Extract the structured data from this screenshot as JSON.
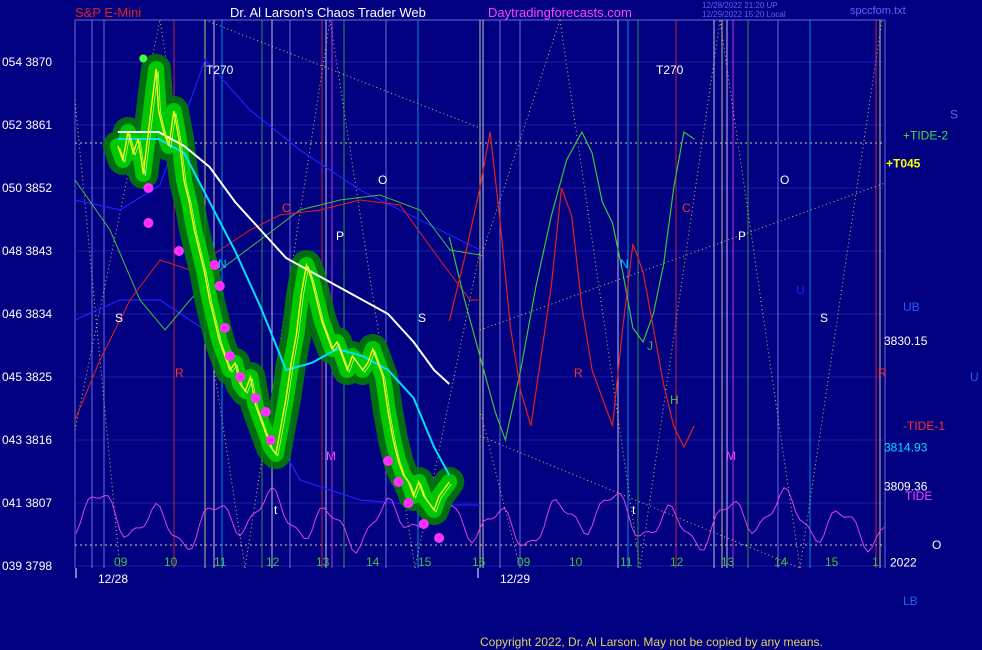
{
  "header": {
    "instrument": "S&P E-Mini",
    "site": "Dr. Al Larson's Chaos Trader Web",
    "url": "Daytradingforecasts.com",
    "stamp_line1": "12/28/2022 21:20 UP",
    "stamp_line2": "12/29/2022 15:20 Local",
    "filename": "spccfom.txt"
  },
  "footer": {
    "copyright": "Copyright 2022, Dr. Al Larson. May not be copied by any means."
  },
  "colors": {
    "background": "#000080",
    "plot_frame": "#6a6ad8",
    "price_line": "#ffff00",
    "bands": "#00c800",
    "magenta_dots": "#ff30ff",
    "moving_avg_slow": "#ffffff",
    "moving_avg_fast": "#00e0ff",
    "tide_green": "#40c040",
    "tide_red": "#e02020",
    "lower_oscillator": "#e040e0",
    "envelope_blue": "#2020ff"
  },
  "chart_data": {
    "type": "line",
    "title": "S&P E-Mini",
    "y_axis": {
      "range": [
        3798,
        3872
      ],
      "ticks": [
        {
          "price": 3870,
          "code": "054"
        },
        {
          "price": 3861,
          "code": "052"
        },
        {
          "price": 3852,
          "code": "050"
        },
        {
          "price": 3843,
          "code": "048"
        },
        {
          "price": 3834,
          "code": "046"
        },
        {
          "price": 3825,
          "code": "045"
        },
        {
          "price": 3816,
          "code": "043"
        },
        {
          "price": 3807,
          "code": "041"
        },
        {
          "price": 3798,
          "code": "039"
        }
      ]
    },
    "x_axis": {
      "hour_ticks": [
        "09",
        "10",
        "11",
        "12",
        "13",
        "14",
        "15",
        "16",
        "09",
        "10",
        "11",
        "12",
        "13",
        "14",
        "15",
        "1"
      ],
      "dates": [
        "12/28",
        "12/29"
      ]
    },
    "price_series": {
      "name": "price",
      "points": [
        [
          9.0,
          3858
        ],
        [
          9.1,
          3856
        ],
        [
          9.2,
          3860
        ],
        [
          9.3,
          3857
        ],
        [
          9.4,
          3859
        ],
        [
          9.5,
          3854
        ],
        [
          9.6,
          3860
        ],
        [
          9.7,
          3866
        ],
        [
          9.75,
          3869
        ],
        [
          9.8,
          3863
        ],
        [
          9.9,
          3860
        ],
        [
          10.0,
          3858
        ],
        [
          10.1,
          3863
        ],
        [
          10.2,
          3859
        ],
        [
          10.3,
          3853
        ],
        [
          10.4,
          3850
        ],
        [
          10.5,
          3846
        ],
        [
          10.6,
          3843
        ],
        [
          10.7,
          3840
        ],
        [
          10.8,
          3836
        ],
        [
          10.9,
          3833
        ],
        [
          11.0,
          3830
        ],
        [
          11.1,
          3828
        ],
        [
          11.2,
          3826
        ],
        [
          11.3,
          3827
        ],
        [
          11.4,
          3824
        ],
        [
          11.5,
          3823
        ],
        [
          11.6,
          3825
        ],
        [
          11.7,
          3821
        ],
        [
          11.8,
          3819
        ],
        [
          11.9,
          3817
        ],
        [
          12.0,
          3815
        ],
        [
          12.1,
          3814
        ],
        [
          12.2,
          3818
        ],
        [
          12.3,
          3822
        ],
        [
          12.4,
          3827
        ],
        [
          12.5,
          3831
        ],
        [
          12.6,
          3837
        ],
        [
          12.7,
          3841
        ],
        [
          12.8,
          3839
        ],
        [
          12.9,
          3836
        ],
        [
          13.0,
          3833
        ],
        [
          13.1,
          3831
        ],
        [
          13.2,
          3829
        ],
        [
          13.3,
          3830
        ],
        [
          13.4,
          3828
        ],
        [
          13.5,
          3826
        ],
        [
          13.6,
          3828
        ],
        [
          13.7,
          3827
        ],
        [
          13.8,
          3826
        ],
        [
          13.9,
          3827
        ],
        [
          14.0,
          3829
        ],
        [
          14.1,
          3827
        ],
        [
          14.2,
          3825
        ],
        [
          14.3,
          3820
        ],
        [
          14.4,
          3816
        ],
        [
          14.5,
          3813
        ],
        [
          14.6,
          3811
        ],
        [
          14.7,
          3810
        ],
        [
          14.8,
          3808
        ],
        [
          14.9,
          3810
        ],
        [
          15.0,
          3808
        ],
        [
          15.1,
          3807
        ],
        [
          15.2,
          3806
        ],
        [
          15.3,
          3808
        ],
        [
          15.4,
          3809
        ],
        [
          15.5,
          3810
        ]
      ]
    },
    "moving_averages": [
      {
        "name": "slow",
        "points": [
          [
            9.0,
            3860
          ],
          [
            9.8,
            3860
          ],
          [
            10.3,
            3858
          ],
          [
            10.8,
            3855
          ],
          [
            11.3,
            3850
          ],
          [
            11.8,
            3846
          ],
          [
            12.3,
            3842
          ],
          [
            12.8,
            3840
          ],
          [
            13.3,
            3838
          ],
          [
            13.8,
            3836
          ],
          [
            14.3,
            3834
          ],
          [
            14.8,
            3830
          ],
          [
            15.2,
            3826
          ],
          [
            15.5,
            3824
          ]
        ]
      },
      {
        "name": "fast",
        "points": [
          [
            9.0,
            3859
          ],
          [
            9.8,
            3859
          ],
          [
            10.3,
            3857
          ],
          [
            10.8,
            3850
          ],
          [
            11.3,
            3843
          ],
          [
            11.8,
            3835
          ],
          [
            12.3,
            3826
          ],
          [
            12.8,
            3827
          ],
          [
            13.3,
            3829
          ],
          [
            13.8,
            3828
          ],
          [
            14.3,
            3826
          ],
          [
            14.8,
            3822
          ],
          [
            15.2,
            3815
          ],
          [
            15.5,
            3811
          ]
        ]
      }
    ],
    "magenta_dots": [
      [
        9.6,
        3852
      ],
      [
        9.6,
        3847
      ],
      [
        10.2,
        3843
      ],
      [
        10.9,
        3841
      ],
      [
        11.0,
        3838
      ],
      [
        11.1,
        3832
      ],
      [
        11.2,
        3828
      ],
      [
        11.4,
        3825
      ],
      [
        11.7,
        3822
      ],
      [
        11.9,
        3820
      ],
      [
        12.0,
        3816
      ],
      [
        14.3,
        3813
      ],
      [
        14.5,
        3810
      ],
      [
        14.7,
        3807
      ],
      [
        15.0,
        3804
      ],
      [
        15.3,
        3802
      ]
    ],
    "projection_series": [
      {
        "name": "+TIDE-2",
        "points": [
          [
            15.5,
            3845
          ],
          [
            15.8,
            3836
          ],
          [
            16.1,
            3828
          ],
          [
            16.4,
            3820
          ],
          [
            16.6,
            3816
          ],
          [
            16.9,
            3826
          ],
          [
            17.2,
            3838
          ],
          [
            17.5,
            3848
          ],
          [
            17.8,
            3856
          ],
          [
            18.1,
            3860
          ],
          [
            18.3,
            3857
          ],
          [
            18.5,
            3850
          ],
          [
            18.7,
            3847
          ],
          [
            18.9,
            3840
          ],
          [
            19.1,
            3832
          ],
          [
            19.3,
            3830
          ],
          [
            19.5,
            3834
          ],
          [
            19.7,
            3841
          ],
          [
            19.9,
            3852
          ],
          [
            20.1,
            3860
          ],
          [
            20.3,
            3859
          ]
        ]
      },
      {
        "name": "-TIDE-1",
        "points": [
          [
            15.5,
            3833
          ],
          [
            15.8,
            3842
          ],
          [
            16.1,
            3852
          ],
          [
            16.3,
            3860
          ],
          [
            16.5,
            3847
          ],
          [
            16.7,
            3832
          ],
          [
            16.9,
            3823
          ],
          [
            17.1,
            3818
          ],
          [
            17.3,
            3828
          ],
          [
            17.5,
            3838
          ],
          [
            17.7,
            3852
          ],
          [
            17.9,
            3848
          ],
          [
            18.1,
            3835
          ],
          [
            18.3,
            3826
          ],
          [
            18.5,
            3822
          ],
          [
            18.7,
            3818
          ],
          [
            18.9,
            3832
          ],
          [
            19.1,
            3844
          ],
          [
            19.3,
            3840
          ],
          [
            19.5,
            3832
          ],
          [
            19.7,
            3824
          ],
          [
            19.9,
            3818
          ],
          [
            20.1,
            3815
          ],
          [
            20.3,
            3818
          ]
        ]
      }
    ],
    "right_labels": [
      {
        "text": "+TIDE-2",
        "price": 3859.5
      },
      {
        "text": "+T045",
        "price": 3855.5
      },
      {
        "text": "S",
        "price": 3862.5
      },
      {
        "text": "UB",
        "price": 3835
      },
      {
        "text": "3830.15",
        "price": 3830.15
      },
      {
        "text": "U",
        "price": 3825
      },
      {
        "text": "-TIDE-1",
        "price": 3818
      },
      {
        "text": "3814.93",
        "price": 3814.93
      },
      {
        "text": "3809.36",
        "price": 3809.36
      },
      {
        "text": "TIDE",
        "price": 3808
      },
      {
        "text": "O",
        "price": 3801
      },
      {
        "text": "2022",
        "price": 3798.5
      },
      {
        "text": "LB",
        "price": 3793
      }
    ],
    "annotations": [
      "T270",
      "T270",
      "S",
      "R",
      "C",
      "N",
      "P",
      "O",
      "t",
      "M",
      "S",
      "R",
      "C",
      "N",
      "J",
      "H",
      "P",
      "O",
      "U",
      "M",
      "t",
      "S",
      "R"
    ]
  }
}
